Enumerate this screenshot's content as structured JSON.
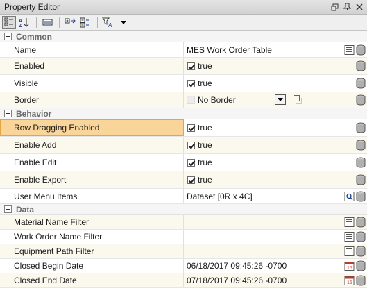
{
  "window": {
    "title": "Property Editor"
  },
  "categories": {
    "common": "Common",
    "behavior": "Behavior",
    "data": "Data"
  },
  "rows": {
    "name": {
      "label": "Name",
      "value": "MES Work Order Table"
    },
    "enabled": {
      "label": "Enabled",
      "value": "true"
    },
    "visible": {
      "label": "Visible",
      "value": "true"
    },
    "border": {
      "label": "Border",
      "value": "No Border"
    },
    "row_dragging": {
      "label": "Row Dragging Enabled",
      "value": "true"
    },
    "enable_add": {
      "label": "Enable Add",
      "value": "true"
    },
    "enable_edit": {
      "label": "Enable Edit",
      "value": "true"
    },
    "enable_export": {
      "label": "Enable Export",
      "value": "true"
    },
    "user_menu": {
      "label": "User Menu Items",
      "value": "Dataset [0R x 4C]"
    },
    "material_filter": {
      "label": "Material Name Filter",
      "value": ""
    },
    "work_order_filter": {
      "label": "Work Order Name Filter",
      "value": ""
    },
    "equipment_filter": {
      "label": "Equipment Path Filter",
      "value": ""
    },
    "closed_begin": {
      "label": "Closed Begin Date",
      "value": "06/18/2017 09:45:26 -0700"
    },
    "closed_end": {
      "label": "Closed End Date",
      "value": "07/18/2017 09:45:26 -0700"
    }
  },
  "colors": {
    "selected_row": "#fad59a",
    "alt_row": "#fbf9ee",
    "category": "#6a6a6a"
  }
}
